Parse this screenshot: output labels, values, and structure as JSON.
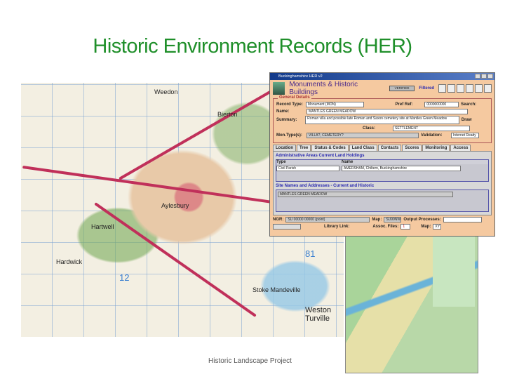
{
  "slide": {
    "title": "Historic Environment Records (HER)",
    "footer": "Historic Landscape Project"
  },
  "map": {
    "labels": [
      "Weedon",
      "Aylesbury",
      "Hardwick",
      "Bierton",
      "Stoke Mandeville",
      "Weston Turville",
      "Hartwell"
    ],
    "grid_numbers": [
      "81",
      "12"
    ]
  },
  "database_window": {
    "window_title": "Buckinghamshire HER v2",
    "app_title": "Monuments & Historic Buildings",
    "status": "VERIFIED",
    "filtered": "Filtered",
    "section_general": "General Details",
    "record_type_label": "Record Type:",
    "record_type_value": "Monument (MON)",
    "pref_ref_label": "Pref Ref:",
    "pref_ref_value": "0000000000",
    "search_label": "Search:",
    "name_label": "Name:",
    "name_value": "MANTLES GREEN MEADOW",
    "summary_label": "Summary:",
    "summary_value": "Roman villa and possible late Roman and Saxon cemetery site at Mantles Green Meadow",
    "draw_label": "Draw",
    "class_label": "Class:",
    "class_value": "SETTLEMENT",
    "mon_types_label": "Mon.Type(s):",
    "mon_types_value": "VILLA?, CEMETERY?",
    "validation_label": "Validation:",
    "validation_value": "Internet Ready",
    "tabs": [
      "Location",
      "Tree",
      "Status & Codes",
      "Land Class",
      "Contacts",
      "Scores",
      "Monitoring",
      "Access"
    ],
    "admin_areas_title": "Administrative Areas  Current Land Holdings",
    "admin_columns": [
      "Type",
      "Name"
    ],
    "admin_row": {
      "type": "Civil Parish",
      "name": "AMERSHAM, Chiltern, Buckinghamshire"
    },
    "site_names_title": "Site Names and Addresses - Current and Historic",
    "site_name": "MANTLES GREEN MEADOW",
    "ngr_label": "NGR:",
    "ngr_value": "SU 00000 00000 (point)",
    "map_label": "Map:",
    "map_value": "SU99NW",
    "output_label": "Output Processes:",
    "library_label": "Library Link:",
    "assoc_files_label": "Assoc. Files:",
    "files_count": "1",
    "map_btn_label": "Map:",
    "xy_label": "XY"
  }
}
